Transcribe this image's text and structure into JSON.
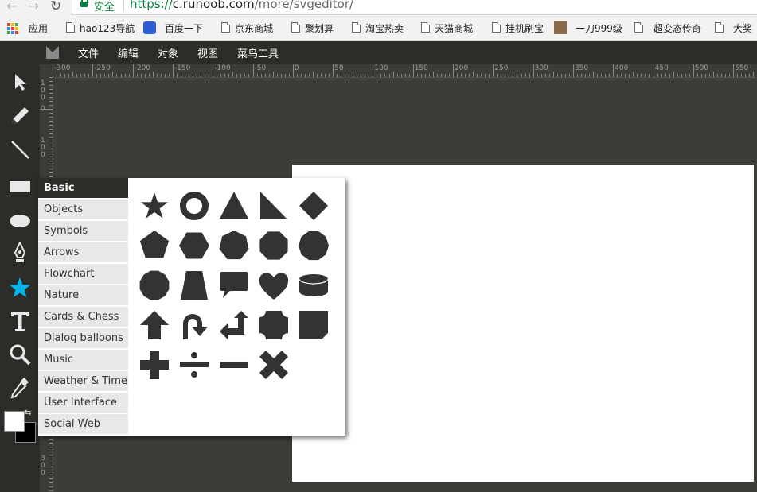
{
  "browser": {
    "secure_label": "安全",
    "url_prefix": "https://",
    "url_host": "c.runoob.com",
    "url_path": "/more/svgeditor/",
    "bookmarks": [
      "应用",
      "hao123导航",
      "百度一下",
      "京东商城",
      "聚划算",
      "淘宝热卖",
      "天猫商城",
      "挂机刷宝",
      "一刀999级",
      "超变态传奇",
      "大奖"
    ]
  },
  "menu": [
    "文件",
    "编辑",
    "对象",
    "视图",
    "菜鸟工具"
  ],
  "tools": [
    "select-icon",
    "pencil-icon",
    "line-icon",
    "rectangle-icon",
    "ellipse-icon",
    "pen-icon",
    "star-icon",
    "text-icon",
    "zoom-icon",
    "eyedropper-icon"
  ],
  "ruler": {
    "h_labels": [
      "-300",
      "-250",
      "-200",
      "-150",
      "-100",
      "-50",
      "0",
      "50",
      "100",
      "150",
      "200",
      "250",
      "300",
      "350",
      "400",
      "450",
      "500",
      "550"
    ],
    "v_labels": [
      "1\n0\n0",
      "0",
      "1\n0\n0",
      "2\n0\n0",
      "3\n0\n0"
    ]
  },
  "library": {
    "categories": [
      "Basic",
      "Objects",
      "Symbols",
      "Arrows",
      "Flowchart",
      "Nature",
      "Cards & Chess",
      "Dialog balloons",
      "Music",
      "Weather & Time",
      "User Interface",
      "Social Web"
    ],
    "selected": "Basic",
    "shapes": [
      "star",
      "donut",
      "triangle",
      "right-triangle",
      "diamond",
      "pentagon",
      "hexagon",
      "heptagon",
      "octagon",
      "decagon",
      "dodecagon",
      "trapezoid",
      "dialog-balloon",
      "heart",
      "cylinder",
      "arrow-up",
      "arrow-u-turn",
      "arrow-left-up",
      "plaque",
      "folded-corner",
      "plus",
      "divide",
      "minus",
      "times"
    ]
  },
  "colors": {
    "accent": "#00b4e6",
    "chrome_dark": "#2c2c28",
    "ruler_bg": "#3d3d38",
    "shape_fill": "#333333",
    "secure_green": "#0b8043"
  }
}
